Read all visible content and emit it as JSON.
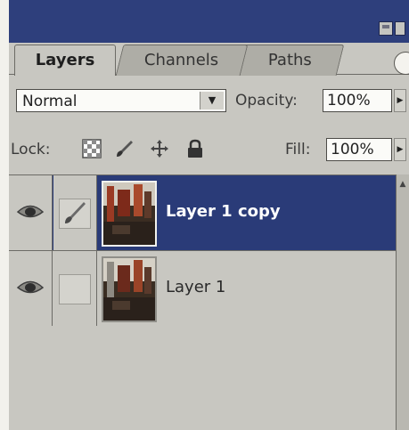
{
  "tabs": [
    {
      "label": "Layers",
      "active": true
    },
    {
      "label": "Channels",
      "active": false
    },
    {
      "label": "Paths",
      "active": false
    }
  ],
  "blend_mode": {
    "value": "Normal"
  },
  "opacity": {
    "label": "Opacity:",
    "value": "100%"
  },
  "lock": {
    "label": "Lock:",
    "icons": [
      "lock-transparency-icon",
      "lock-image-icon",
      "lock-position-icon",
      "lock-all-icon"
    ]
  },
  "fill": {
    "label": "Fill:",
    "value": "100%"
  },
  "layers": [
    {
      "name": "Layer 1 copy",
      "selected": true,
      "visible": true,
      "brush_icon": "brush-icon"
    },
    {
      "name": "Layer 1",
      "selected": false,
      "visible": true,
      "brush_icon": ""
    }
  ],
  "colors": {
    "titlebar": "#2e3f7c",
    "selection": "#2a3b78",
    "panel": "#c8c7c1"
  }
}
